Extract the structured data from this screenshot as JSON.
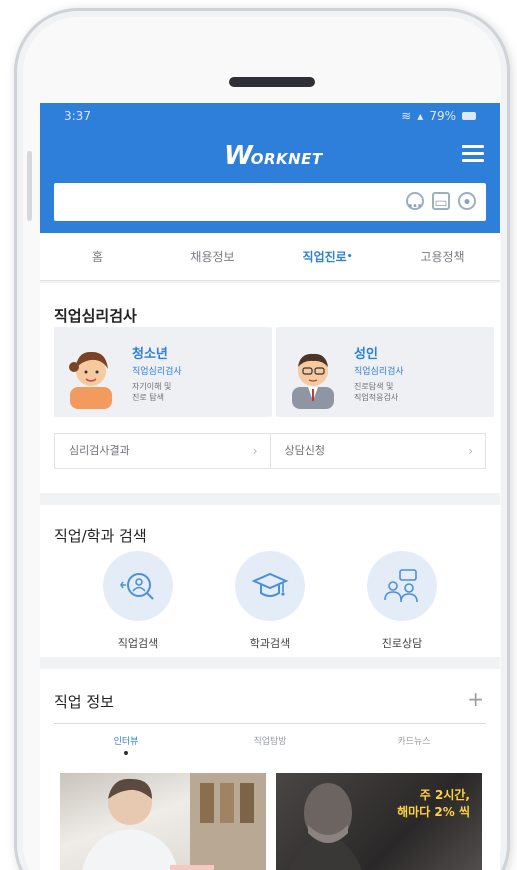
{
  "status": {
    "time": "3:37",
    "battery": "79%"
  },
  "header": {
    "logo_w": "W",
    "logo_rest": "ORKNET"
  },
  "search": {
    "placeholder": ""
  },
  "tabs": [
    {
      "label": "홈"
    },
    {
      "label": "채용정보"
    },
    {
      "label": "직업진로",
      "active": true
    },
    {
      "label": "고용정책"
    }
  ],
  "psych": {
    "title": "직업심리검사",
    "youth": {
      "name": "청소년",
      "sub": "직업심리검사",
      "desc1": "자기이해 및",
      "desc2": "진로 탐색"
    },
    "adult": {
      "name": "성인",
      "sub": "직업심리검사",
      "desc1": "진로탐색 및",
      "desc2": "직업적응검사"
    },
    "links": [
      {
        "label": "심리검사결과"
      },
      {
        "label": "상담신청"
      }
    ]
  },
  "job_search": {
    "title": "직업/학과 검색",
    "items": [
      {
        "label": "직업검색",
        "icon": "job-search-icon"
      },
      {
        "label": "학과검색",
        "icon": "graduation-cap-icon"
      },
      {
        "label": "진로상담",
        "icon": "counseling-icon"
      }
    ]
  },
  "job_info": {
    "title": "직업 정보",
    "plus": "+",
    "tabs": [
      {
        "label": "인터뷰",
        "active": true
      },
      {
        "label": "직업탐방"
      },
      {
        "label": "카드뉴스"
      }
    ],
    "card_b_text1": "주 2시간,",
    "card_b_text2": "해마다 2% 씩"
  },
  "colors": {
    "accent": "#2e7fd9",
    "background": "#f1f2f4"
  }
}
